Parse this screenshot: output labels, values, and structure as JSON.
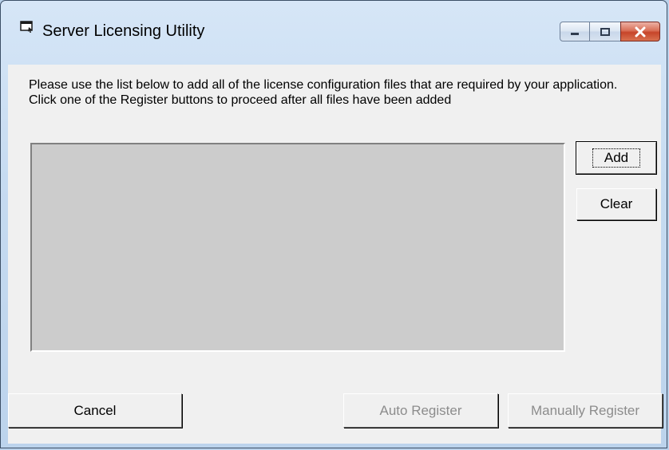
{
  "window": {
    "title": "Server Licensing Utility",
    "caption_buttons": [
      "minimize",
      "maximize",
      "close"
    ]
  },
  "instructions": "Please use the list below to add all of the license configuration files that are required by your application. Click one of the Register buttons to proceed after all files have been added",
  "license_files": {
    "items": []
  },
  "buttons": {
    "add": "Add",
    "clear": "Clear",
    "cancel": "Cancel",
    "auto_register": "Auto Register",
    "manually_register": "Manually Register"
  },
  "state": {
    "auto_register_enabled": false,
    "manually_register_enabled": false,
    "default_button": "add"
  }
}
